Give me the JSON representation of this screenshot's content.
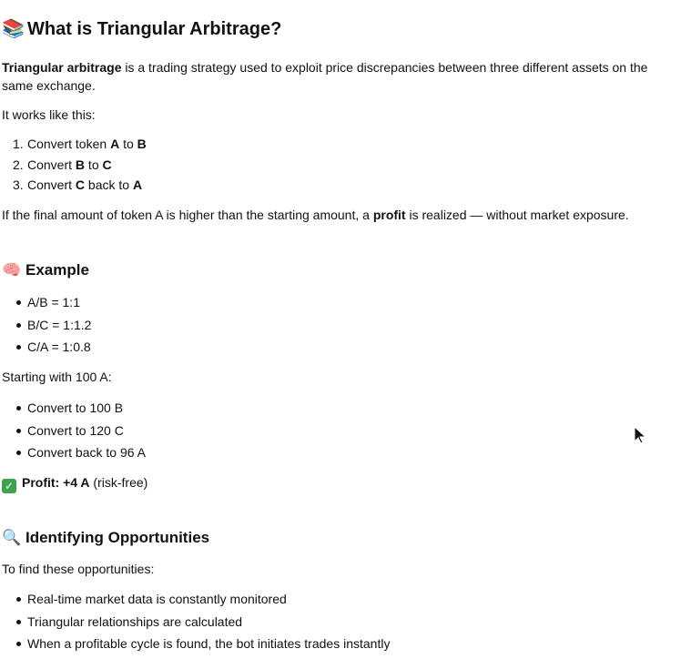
{
  "title": {
    "emoji": "📚",
    "text": "What is Triangular Arbitrage?"
  },
  "intro": {
    "bold": "Triangular arbitrage",
    "rest": " is a trading strategy used to exploit price discrepancies between three different assets on the same exchange."
  },
  "works_like": "It works like this:",
  "steps": [
    {
      "num": "1.",
      "pre": "Convert token ",
      "a": "A",
      "mid": " to ",
      "b": "B",
      "post": ""
    },
    {
      "num": "2.",
      "pre": "Convert ",
      "a": "B",
      "mid": " to ",
      "b": "C",
      "post": ""
    },
    {
      "num": "3.",
      "pre": "Convert ",
      "a": "C",
      "mid": " back to ",
      "b": "A",
      "post": ""
    }
  ],
  "conclusion": {
    "pre": "If the final amount of token A is higher than the starting amount, a ",
    "bold": "profit",
    "post": " is realized — without market exposure."
  },
  "example": {
    "emoji": "🧠",
    "heading": "Example",
    "rates": [
      "A/B = 1:1",
      "B/C = 1:1.2",
      "C/A = 1:0.8"
    ],
    "starting": "Starting with 100 A:",
    "conversions": [
      "Convert to 100 B",
      "Convert to 120 C",
      "Convert back to 96 A"
    ],
    "profit_icon": "check-mark-icon",
    "profit_bold": "Profit: +4 A",
    "profit_note": " (risk-free)"
  },
  "opportunities": {
    "emoji": "🔍",
    "heading": "Identifying Opportunities",
    "lead": "To find these opportunities:",
    "items": [
      "Real-time market data is constantly monitored",
      "Triangular relationships are calculated",
      "When a profitable cycle is found, the bot initiates trades instantly"
    ]
  }
}
